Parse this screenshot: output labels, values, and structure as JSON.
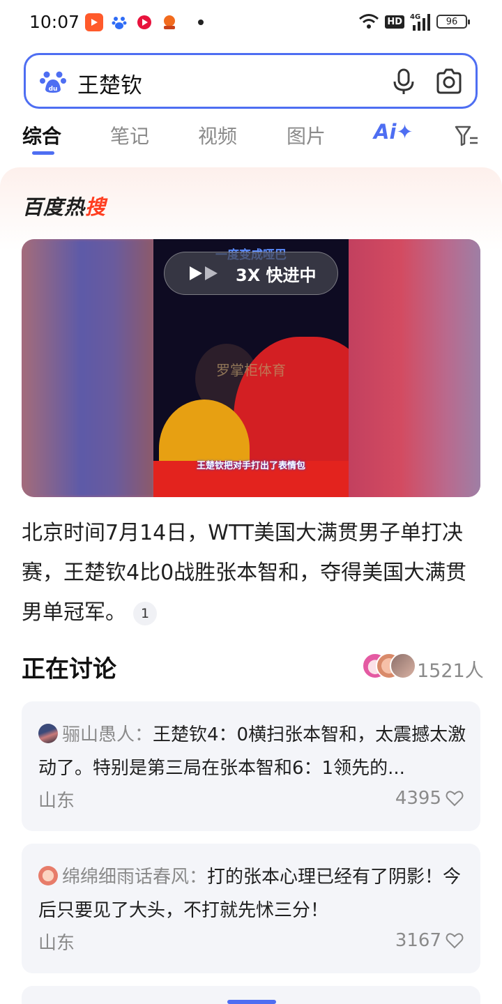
{
  "status_bar": {
    "time": "10:07",
    "network": "4G",
    "hd": "HD",
    "battery": "96"
  },
  "search": {
    "query": "王楚钦"
  },
  "tabs": [
    {
      "label": "综合"
    },
    {
      "label": "笔记"
    },
    {
      "label": "视频"
    },
    {
      "label": "图片"
    }
  ],
  "tab_ai_label": "Ai✦",
  "hot": {
    "title_part1": "百度热",
    "title_part2": "搜"
  },
  "video": {
    "caption_top": "一度变成哑巴",
    "watermark": "罗掌柜体育",
    "caption_bottom": "王楚钦把对手打出了表情包",
    "speed_label": "3X 快进中"
  },
  "summary": {
    "text": "北京时间7月14日，WTT美国大满贯男子单打决赛，王楚钦4比0战胜张本智和，夺得美国大满贯男单冠军。",
    "ref": "1"
  },
  "discussion": {
    "title": "正在讨论",
    "count": "1521人",
    "comments": [
      {
        "author": "骊山愚人：",
        "text": "王楚钦4：0横扫张本智和，太震撼太激动了。特别是第三局在张本智和6：1领先的...",
        "location": "山东",
        "likes": "4395"
      },
      {
        "author": "绵绵细雨话春风：",
        "text": "打的张本心理已经有了阴影！今后只要见了大头，不打就先怵三分！",
        "location": "山东",
        "likes": "3167"
      }
    ]
  },
  "colors": {
    "accent": "#4e6ef2",
    "hot_red": "#ff3d1f"
  }
}
